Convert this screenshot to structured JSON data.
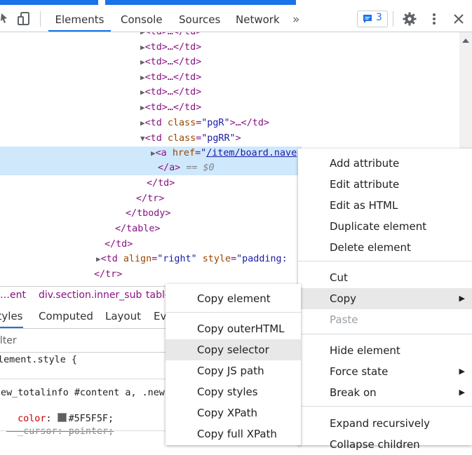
{
  "toolbar": {
    "tabs": [
      "Elements",
      "Console",
      "Sources",
      "Network"
    ],
    "more_tabs": "»",
    "issues_count": "3"
  },
  "tree": {
    "td_collapsed": "<td>…</td>",
    "td_pgR_tag": "<td ",
    "td_pgR_attr": "class",
    "td_pgR_val": "\"pgR\"",
    "td_pgR_tail": ">…</td>",
    "td_pgRR_attr": "class",
    "td_pgRR_val": "\"pgRR\"",
    "a_attr": "href",
    "a_href": "/item/board.nave",
    "a_close": "</a>",
    "eq_marker": "== $0",
    "close_td": "</td>",
    "close_tr": "</tr>",
    "close_tbody": "</tbody>",
    "close_table": "</table>",
    "close_td2": "</td>",
    "td_align_attr": "align",
    "td_align_val": "\"right\"",
    "td_style_attr": "style",
    "td_style_val": "\"padding:",
    "close_tr2": "</tr>"
  },
  "breadcrumb": {
    "item1": "…ent",
    "item2": "div.section.inner_sub",
    "item3": "table"
  },
  "subtabs": [
    "Styles",
    "Computed",
    "Layout",
    "Event Listeners"
  ],
  "filter": {
    "placeholder": "Filter"
  },
  "styles": {
    "element_style": "element.style {",
    "selector": "new_totalinfo #content a, .new",
    "color_prop": "color",
    "color_val": "#5F5F5F;",
    "color_swatch": "#5F5F5F",
    "cursor_prop": "_cursor",
    "cursor_val": "pointer;"
  },
  "context_menu": {
    "items": [
      "Add attribute",
      "Edit attribute",
      "Edit as HTML",
      "Duplicate element",
      "Delete element",
      "Cut",
      "Copy",
      "Paste",
      "Hide element",
      "Force state",
      "Break on",
      "Expand recursively",
      "Collapse children"
    ]
  },
  "copy_submenu": {
    "items": [
      "Copy element",
      "Copy outerHTML",
      "Copy selector",
      "Copy JS path",
      "Copy styles",
      "Copy XPath",
      "Copy full XPath"
    ]
  }
}
